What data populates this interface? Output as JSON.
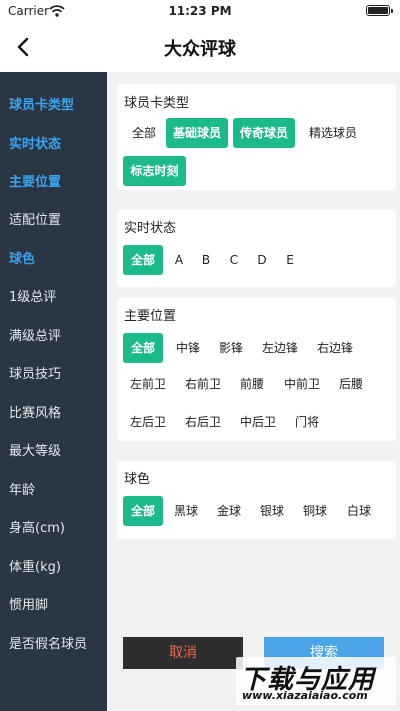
{
  "status": {
    "carrier": "Carrier",
    "time": "11:23 PM"
  },
  "nav": {
    "title": "大众评球"
  },
  "sidebar": {
    "items": [
      {
        "label": "球员卡类型",
        "active": true
      },
      {
        "label": "实时状态",
        "active": true
      },
      {
        "label": "主要位置",
        "active": true
      },
      {
        "label": "适配位置",
        "active": false
      },
      {
        "label": "球色",
        "active": true
      },
      {
        "label": "1级总评",
        "active": false
      },
      {
        "label": "满级总评",
        "active": false
      },
      {
        "label": "球员技巧",
        "active": false
      },
      {
        "label": "比赛风格",
        "active": false
      },
      {
        "label": "最大等级",
        "active": false
      },
      {
        "label": "年龄",
        "active": false
      },
      {
        "label": "身高(cm)",
        "active": false
      },
      {
        "label": "体重(kg)",
        "active": false
      },
      {
        "label": "惯用脚",
        "active": false
      },
      {
        "label": "是否假名球员",
        "active": false
      }
    ]
  },
  "filters": {
    "card_type": {
      "title": "球员卡类型",
      "options": [
        {
          "label": "全部",
          "selected": false
        },
        {
          "label": "基础球员",
          "selected": true
        },
        {
          "label": "传奇球员",
          "selected": true
        },
        {
          "label": "精选球员",
          "selected": false
        },
        {
          "label": "标志时刻",
          "selected": true
        }
      ]
    },
    "status": {
      "title": "实时状态",
      "options": [
        {
          "label": "全部",
          "selected": true
        },
        {
          "label": "A",
          "selected": false
        },
        {
          "label": "B",
          "selected": false
        },
        {
          "label": "C",
          "selected": false
        },
        {
          "label": "D",
          "selected": false
        },
        {
          "label": "E",
          "selected": false
        }
      ]
    },
    "position": {
      "title": "主要位置",
      "options": [
        {
          "label": "全部",
          "selected": true
        },
        {
          "label": "中锋",
          "selected": false
        },
        {
          "label": "影锋",
          "selected": false
        },
        {
          "label": "左边锋",
          "selected": false
        },
        {
          "label": "右边锋",
          "selected": false
        },
        {
          "label": "左前卫",
          "selected": false
        },
        {
          "label": "右前卫",
          "selected": false
        },
        {
          "label": "前腰",
          "selected": false
        },
        {
          "label": "中前卫",
          "selected": false
        },
        {
          "label": "后腰",
          "selected": false
        },
        {
          "label": "左后卫",
          "selected": false
        },
        {
          "label": "右后卫",
          "selected": false
        },
        {
          "label": "中后卫",
          "selected": false
        },
        {
          "label": "门将",
          "selected": false
        }
      ]
    },
    "ball_color": {
      "title": "球色",
      "options": [
        {
          "label": "全部",
          "selected": true
        },
        {
          "label": "黑球",
          "selected": false
        },
        {
          "label": "金球",
          "selected": false
        },
        {
          "label": "银球",
          "selected": false
        },
        {
          "label": "铜球",
          "selected": false
        },
        {
          "label": "白球",
          "selected": false
        }
      ]
    }
  },
  "actions": {
    "cancel": "取消",
    "search": "搜索"
  },
  "watermark": {
    "title": "下载与应用",
    "url": "www.xiazaiaiao.com"
  },
  "colors": {
    "selected": "#1cb98a",
    "sidebar_bg": "#2b3645",
    "sidebar_active": "#3aa5f0",
    "search_button": "#4ba3e8",
    "cancel_text": "#e8694a"
  },
  "icons": {
    "back": "chevron-left-icon",
    "wifi": "wifi-icon",
    "battery": "battery-icon"
  }
}
